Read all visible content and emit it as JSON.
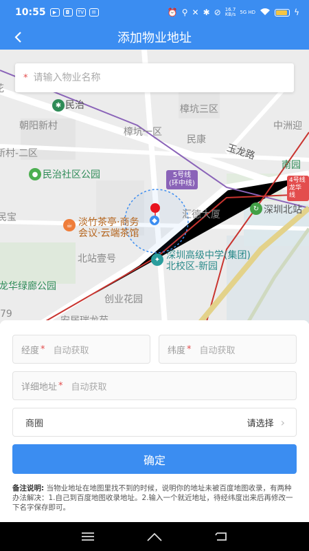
{
  "status": {
    "time": "10:55",
    "app_icons": [
      "▶",
      "◘",
      "TV",
      "✉"
    ],
    "indicators": [
      "⏰",
      "⚲",
      "✕",
      "✱",
      "⊘"
    ],
    "speed": "16.7",
    "speed_unit": "KB/s",
    "network": "5G HD",
    "battery_level": 0.8
  },
  "header": {
    "title": "添加物业地址",
    "back_icon": "chevron-left-icon"
  },
  "map": {
    "search": {
      "required_mark": "*",
      "placeholder": "请输入物业名称"
    },
    "labels": {
      "minzhi": "民治",
      "zhangkeng3": "樟坑三区",
      "zhongzhou": "中洲迎",
      "chaoyang": "朝阳新村",
      "zhangkeng1": "樟坑一区",
      "minkang": "民康",
      "yulong": "玉龙路",
      "xin2": "新村-二区",
      "minzhi_park": "民治社区公园",
      "nanyuan": "南园",
      "huide": "汇德大厦",
      "sz_north": "深圳北站",
      "danzhu": "淡竹茶亭·商务",
      "danzhu2": "会议·云端茶馆",
      "beizhan": "北站壹号",
      "school": "深圳高级中学(集团)",
      "school2": "北校区-新园",
      "minbao": "民宝",
      "longhua": "龙华绿廊公园",
      "chuangye": "创业花园",
      "anju": "安居瑞龙苑",
      "n79": "79",
      "huaji": "花"
    },
    "line5": "5号线",
    "line5_sub": "(环中线)",
    "line4": "4号线",
    "line4_sub": "龙华线"
  },
  "form": {
    "longitude": {
      "label": "经度",
      "required": "*",
      "placeholder": "自动获取"
    },
    "latitude": {
      "label": "纬度",
      "required": "*",
      "placeholder": "自动获取"
    },
    "address": {
      "label": "详细地址",
      "required": "*",
      "placeholder": "自动获取"
    },
    "business_area": {
      "label": "商圈",
      "value": "请选择"
    },
    "confirm_label": "确定",
    "note_title": "备注说明:",
    "note_text": "当物业地址在地图里找不到的时候，说明你的地址未被百度地图收录，有两种办法解决：1.自己到百度地图收录地址。2.输入一个就近地址，待经纬度出来后再修改一下名字保存即可。"
  },
  "colors": {
    "primary": "#3b8df1",
    "required": "#e34d4d",
    "line5": "#8a63b8",
    "line4": "#e34d4d",
    "marker": "#e8131f"
  }
}
